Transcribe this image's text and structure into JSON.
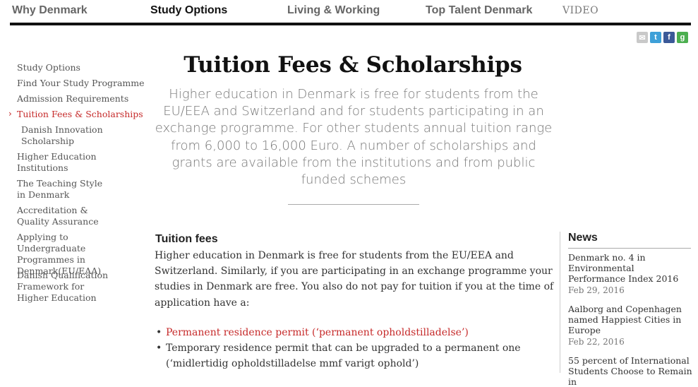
{
  "topnav": {
    "items": [
      {
        "label": "Why Denmark"
      },
      {
        "label": "Study Options"
      },
      {
        "label": "Living & Working"
      },
      {
        "label": "Top Talent Denmark"
      }
    ],
    "video_label": "VIDEO"
  },
  "social": {
    "icons": [
      "email-icon",
      "twitter-icon",
      "facebook-icon",
      "google-plus-icon"
    ],
    "colors": {
      "email": "#b8b8b8",
      "twitter": "#3ea0d8",
      "facebook": "#3b5998",
      "google": "#4caf50"
    }
  },
  "sidebar": {
    "items": [
      {
        "label": "Study Options"
      },
      {
        "label": "Find Your Study Programme"
      },
      {
        "label": "Admission Requirements"
      },
      {
        "label": "Tuition Fees & Scholarships"
      },
      {
        "label": "Danish Innovation Scholarship"
      },
      {
        "label": "Higher Education Institutions"
      },
      {
        "label": "The Teaching Style in Denmark"
      },
      {
        "label": "Accreditation & Quality Assurance"
      },
      {
        "label": "Applying to Undergraduate Programmes in Denmark(EU/EAA)"
      },
      {
        "label": "Danish Qualification Framework for Higher Education"
      }
    ],
    "active_index": 3,
    "accent_color": "#c62a2a"
  },
  "main": {
    "title": "Tuition Fees & Scholarships",
    "intro": "Higher education in Denmark is free for students from the EU/EEA and Switzerland and for students participating in an exchange programme. For other students annual tuition range from 6,000 to 16,000 Euro. A number of scholarships and grants are available from the institutions and from public funded schemes",
    "section_heading": "Tuition fees",
    "body": "Higher education in Denmark is free for students from the EU/EEA and Switzerland. Similarly, if you are participating in an exchange programme your studies in Denmark are free. You also do not pay for tuition if you at the time of application have a:",
    "bullets": [
      "Permanent residence permit (‘permanent opholdstilladelse’)",
      "Temporary residence permit that can be upgraded to a permanent one (‘midlertidig opholdstilladelse mmf varigt ophold’)"
    ],
    "bullet_marker": "•"
  },
  "news": {
    "heading": "News",
    "items": [
      {
        "title": "Denmark no. 4 in Environmental Performance Index 2016",
        "date": "Feb 29, 2016"
      },
      {
        "title": "Aalborg and Copenhagen named Happiest Cities in Europe",
        "date": "Feb 22, 2016"
      },
      {
        "title": "55 percent of International Students Choose to Remain in",
        "date": ""
      }
    ]
  }
}
